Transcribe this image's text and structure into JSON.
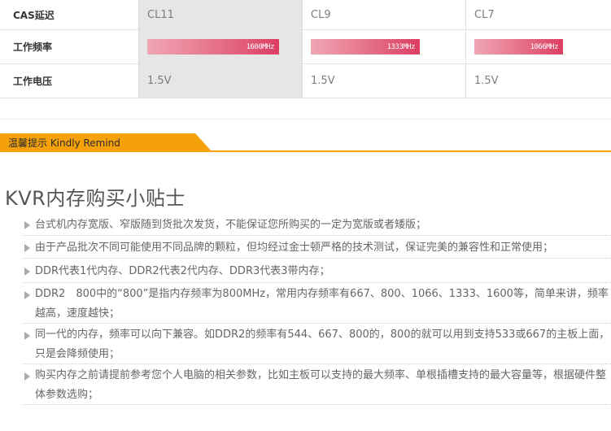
{
  "spec_table": {
    "rows": [
      {
        "label": "CAS延迟",
        "cells": [
          "CL11",
          "CL9",
          "CL7"
        ]
      },
      {
        "label": "工作频率",
        "bars": [
          {
            "text": "1600MHz",
            "fraction": 1.0
          },
          {
            "text": "1333MHz",
            "fraction": 0.83
          },
          {
            "text": "1066MHz",
            "fraction": 0.67
          }
        ]
      },
      {
        "label": "工作电压",
        "cells": [
          "1.5V",
          "1.5V",
          "1.5V"
        ]
      }
    ]
  },
  "remind": {
    "title": "温馨提示 Kindly Remind",
    "accent": "#f5a10a"
  },
  "tips_title": "KVR内存购买小贴士",
  "tips": [
    "台式机内存宽版、窄版随到货批次发货，不能保证您所购买的一定为宽版或者矮版；",
    "由于产品批次不同可能使用不同品牌的颗粒，但均经过金士顿严格的技术测试，保证完美的兼容性和正常使用；",
    "DDR代表1代内存、DDR2代表2代内存、DDR3代表3带内存；",
    "DDR2　800中的“800”是指内存频率为800MHz，常用内存频率有667、800、1066、1333、1600等，简单来讲，频率越高，速度越快；",
    "同一代的内存，频率可以向下兼容。如DDR2的频率有544、667、800的，800的就可以用到支持533或667的主板上面，只是会降频使用；",
    "购买内存之前请提前参考您个人电脑的相关参数，比如主板可以支持的最大频率、单根插槽支持的最大容量等，根据硬件整体参数选购；"
  ]
}
